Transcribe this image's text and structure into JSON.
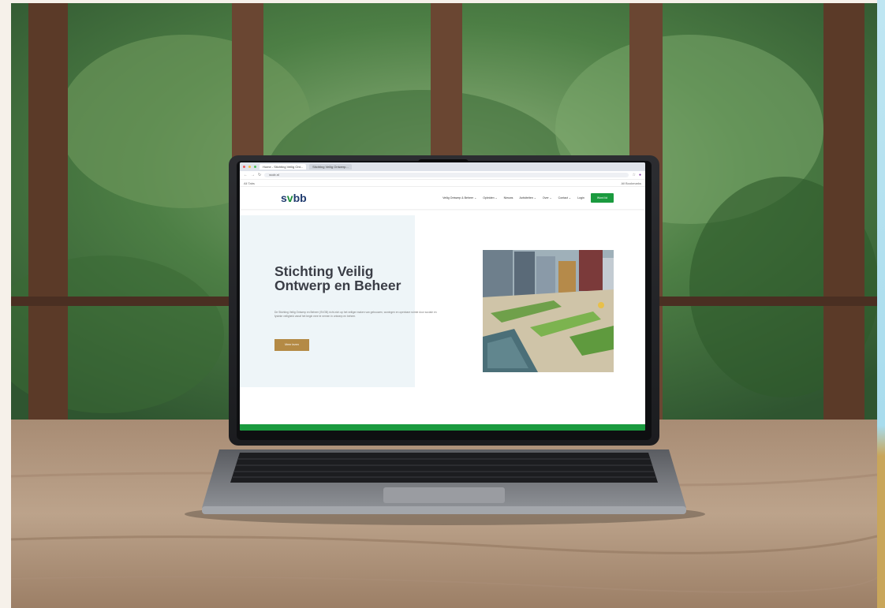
{
  "browser": {
    "tabs": [
      "Home - Stichting Veilig Ont...",
      "Stichting Veilig Ontwerp..."
    ],
    "url": "svob.nl",
    "bookmark_left": "All Tabs",
    "bookmark_right": "All Bookmarks"
  },
  "site": {
    "logo": {
      "s": "s",
      "v": "v",
      "bb": "bb"
    },
    "nav": [
      "Veilig Ontwerp & Beheer ⌄",
      "Opleiden ⌄",
      "Nieuws",
      "Activiteiten ⌄",
      "Over ⌄",
      "Contact ⌄",
      "Login"
    ],
    "nav_cta": "Word lid",
    "hero": {
      "title": "Stichting Veilig Ontwerp en Beheer",
      "text": "De Stichting Veilig Ontwerp en Beheer (SVOB) richt zich op het veiliger maken van gebouwen, woningen en openbare ruimte door sociale en fysieke veiligheid vanaf het begin mee te nemen in ontwerp en beheer.",
      "button": "Meer lezen"
    }
  },
  "colors": {
    "brand_green": "#1a9a3e",
    "brand_navy": "#1f3a6e",
    "button_gold": "#b48a45"
  }
}
